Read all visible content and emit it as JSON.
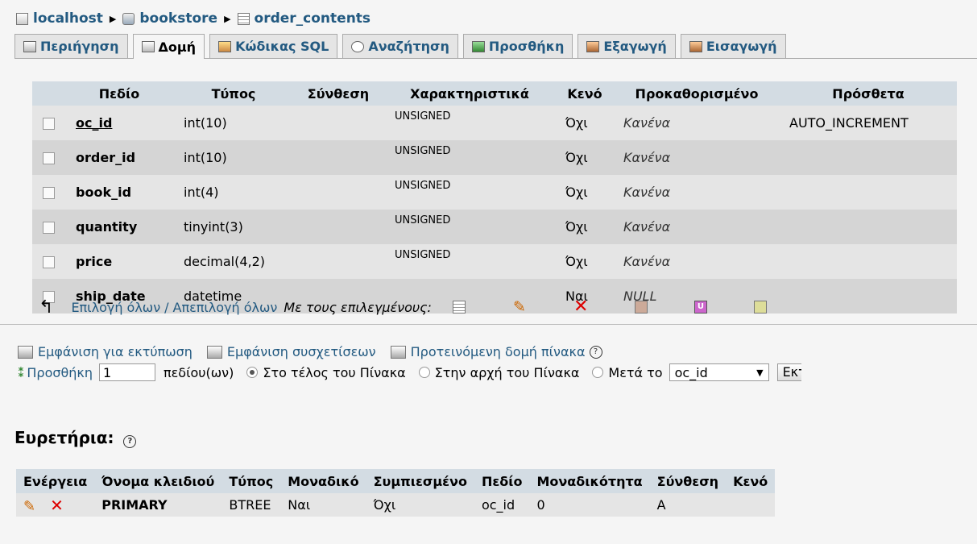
{
  "breadcrumb": {
    "server": "localhost",
    "database": "bookstore",
    "table": "order_contents"
  },
  "tabs": [
    {
      "label": "Περιήγηση",
      "icon": "browse-icon"
    },
    {
      "label": "Δομή",
      "icon": "structure-icon"
    },
    {
      "label": "Κώδικας SQL",
      "icon": "sql-icon"
    },
    {
      "label": "Αναζήτηση",
      "icon": "search-icon"
    },
    {
      "label": "Προσθήκη",
      "icon": "insert-icon"
    },
    {
      "label": "Εξαγωγή",
      "icon": "export-icon"
    },
    {
      "label": "Εισαγωγή",
      "icon": "import-icon"
    }
  ],
  "structure": {
    "headers": [
      "Πεδίο",
      "Τύπος",
      "Σύνθεση",
      "Χαρακτηριστικά",
      "Κενό",
      "Προκαθορισμένο",
      "Πρόσθετα"
    ],
    "rows": [
      {
        "field": "oc_id",
        "type": "int(10)",
        "collation": "",
        "attributes": "UNSIGNED",
        "null": "Όχι",
        "default": "Κανένα",
        "extra": "AUTO_INCREMENT"
      },
      {
        "field": "order_id",
        "type": "int(10)",
        "collation": "",
        "attributes": "UNSIGNED",
        "null": "Όχι",
        "default": "Κανένα",
        "extra": ""
      },
      {
        "field": "book_id",
        "type": "int(4)",
        "collation": "",
        "attributes": "UNSIGNED",
        "null": "Όχι",
        "default": "Κανένα",
        "extra": ""
      },
      {
        "field": "quantity",
        "type": "tinyint(3)",
        "collation": "",
        "attributes": "UNSIGNED",
        "null": "Όχι",
        "default": "Κανένα",
        "extra": ""
      },
      {
        "field": "price",
        "type": "decimal(4,2)",
        "collation": "",
        "attributes": "UNSIGNED",
        "null": "Όχι",
        "default": "Κανένα",
        "extra": ""
      },
      {
        "field": "ship_date",
        "type": "datetime",
        "collation": "",
        "attributes": "",
        "null": "Ναι",
        "default": "NULL",
        "extra": ""
      }
    ]
  },
  "selection": {
    "check_all": "Επιλογή όλων",
    "separator": "/",
    "uncheck_all": "Απεπιλογή όλων",
    "with_selected": "Με τους επιλεγμένους:"
  },
  "links": {
    "print_view": "Εμφάνιση για εκτύπωση",
    "relation_view": "Εμφάνιση συσχετίσεων",
    "propose_structure": "Προτεινόμενη δομή πίνακα"
  },
  "add_field": {
    "label": "Προσθήκη",
    "count": "1",
    "fields_label": "πεδίου(ων)",
    "at_end": "Στο τέλος του Πίνακα",
    "at_beginning": "Στην αρχή του Πίνακα",
    "after": "Μετά το",
    "after_field": "oc_id",
    "go_label": "Εκτέλεση"
  },
  "indexes": {
    "title": "Ευρετήρια:",
    "headers": [
      "Ενέργεια",
      "Όνομα κλειδιού",
      "Τύπος",
      "Μοναδικό",
      "Συμπιεσμένο",
      "Πεδίο",
      "Μοναδικότητα",
      "Σύνθεση",
      "Κενό"
    ],
    "rows": [
      {
        "key_name": "PRIMARY",
        "type": "BTREE",
        "unique": "Ναι",
        "packed": "Όχι",
        "field": "oc_id",
        "cardinality": "0",
        "collation": "A",
        "null": ""
      }
    ]
  }
}
